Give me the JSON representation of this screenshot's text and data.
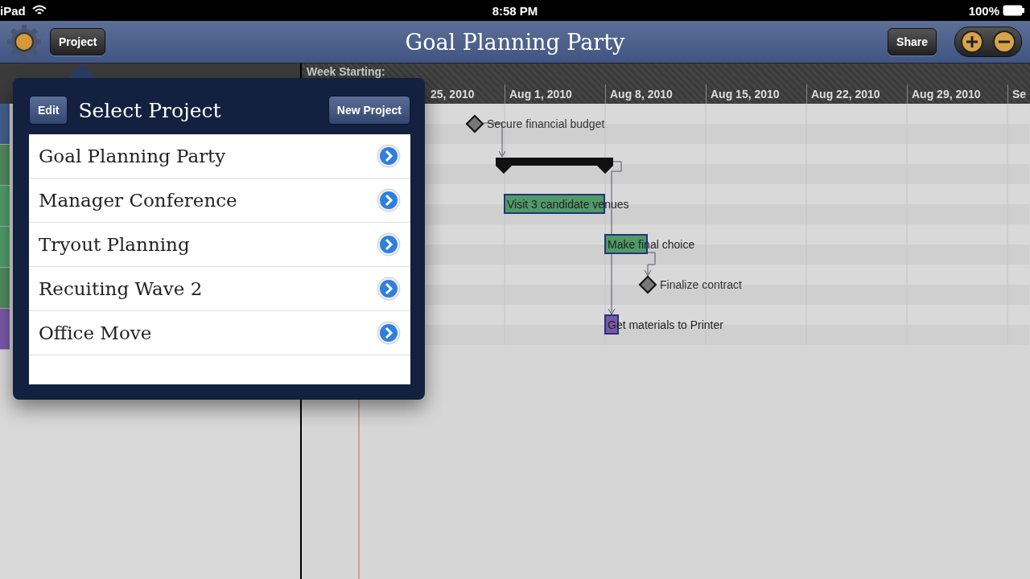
{
  "status_bar": {
    "carrier": "iPad",
    "time": "8:58 PM",
    "battery": "100%"
  },
  "toolbar": {
    "project_button": "Project",
    "title": "Goal Planning Party",
    "share_button": "Share"
  },
  "timeline": {
    "heading": "Week Starting:",
    "weeks": [
      "25, 2010",
      "Aug 1, 2010",
      "Aug 8, 2010",
      "Aug 15, 2010",
      "Aug 22, 2010",
      "Aug 29, 2010",
      "Se"
    ]
  },
  "tasks": [
    {
      "kind": "milestone",
      "label": "Secure financial budget",
      "color": "#44608f"
    },
    {
      "kind": "summary",
      "color": "#4f8a5e"
    },
    {
      "kind": "task",
      "label": "Visit 3 candidate venues",
      "color": "#4f9a68"
    },
    {
      "kind": "task",
      "label": "Make final choice",
      "color": "#4f9a68"
    },
    {
      "kind": "milestone",
      "label": "Finalize contract",
      "color": "#4f8a5e"
    },
    {
      "kind": "task",
      "label": "Get materials to Printer",
      "color": "#7a58a8"
    }
  ],
  "popover": {
    "edit_button": "Edit",
    "title": "Select Project",
    "new_button": "New Project",
    "projects": [
      "Goal Planning Party",
      "Manager Conference",
      "Tryout Planning",
      "Recuiting Wave 2",
      "Office Move"
    ]
  }
}
